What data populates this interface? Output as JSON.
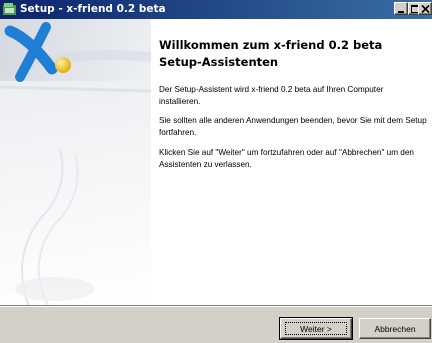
{
  "window": {
    "title": "Setup - x-friend 0.2 beta",
    "controls": [
      "minimize-icon",
      "maximize-icon",
      "close-icon"
    ]
  },
  "wizard": {
    "heading": "Willkommen zum x-friend 0.2 beta Setup-Assistenten",
    "paragraphs": [
      "Der Setup-Assistent wird x-friend 0.2 beta auf Ihren Computer installieren.",
      "Sie sollten alle anderen Anwendungen beenden, bevor Sie mit dem Setup fortfahren.",
      "Klicken Sie auf \"Weiter\" um fortzufahren oder auf \"Abbrechen\" um den Assistenten zu verlassen."
    ]
  },
  "buttons": {
    "next": "Weiter >",
    "cancel": "Abbrechen"
  },
  "colors": {
    "titlebar_start": "#0a246a",
    "titlebar_end": "#3a6ea5",
    "face": "#d4d0c8",
    "logo_blue": "#1f7fd6",
    "logo_yellow": "#f2c21b"
  }
}
